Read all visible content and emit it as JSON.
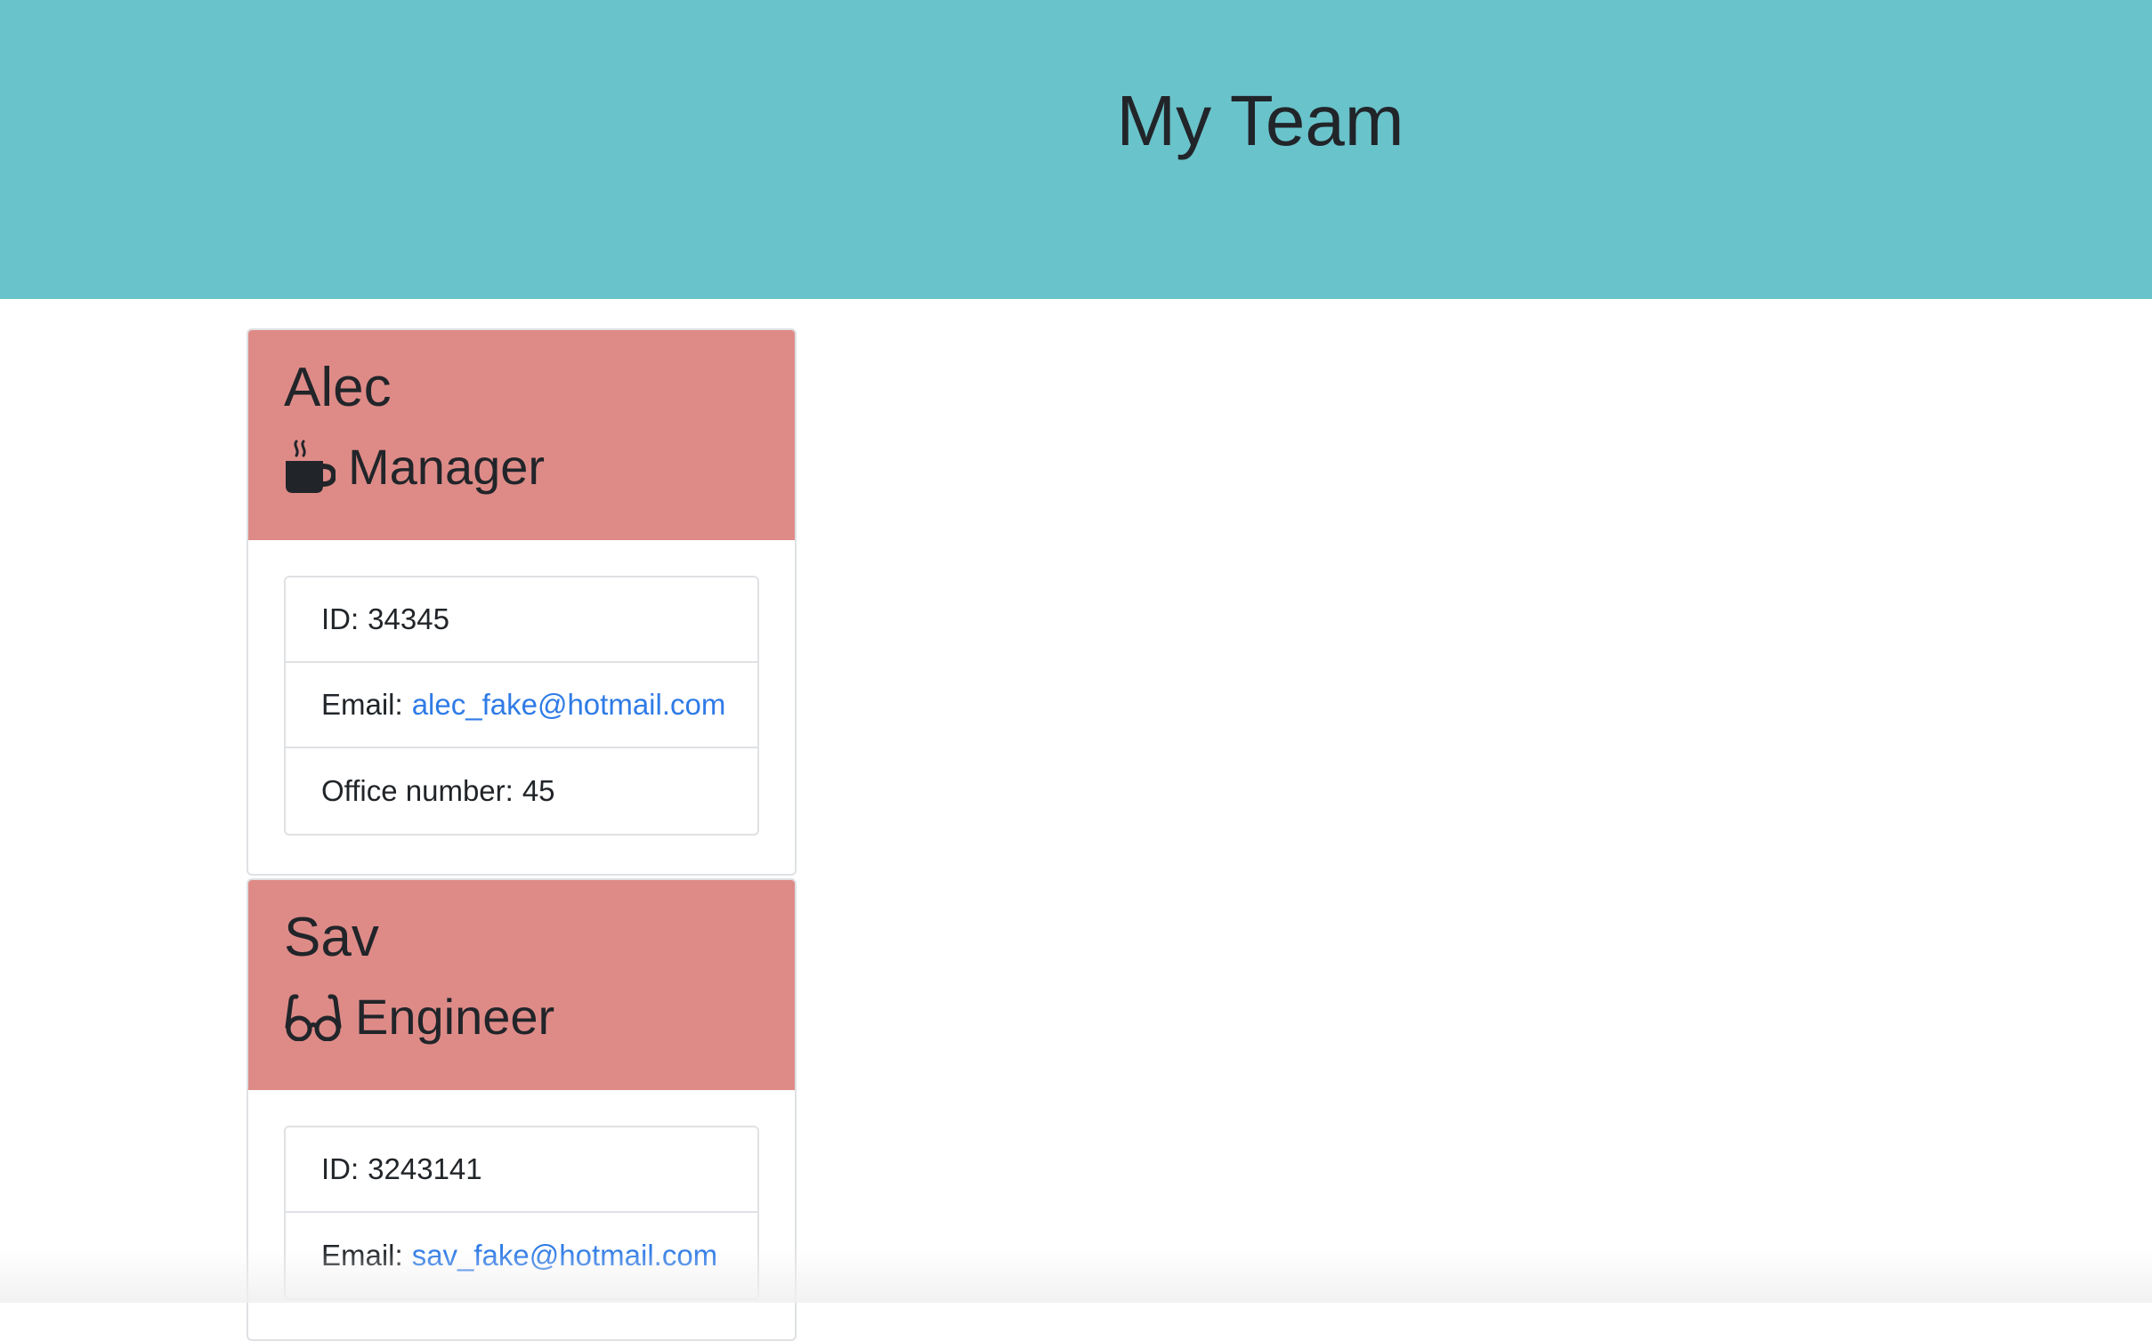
{
  "header": {
    "title": "My Team",
    "background_color": "#69c3cb"
  },
  "employees": [
    {
      "name": "Alec",
      "role": "Manager",
      "role_icon": "mug-hot-icon",
      "header_color": "#de8b88",
      "id_label": "ID:",
      "id_value": "34345",
      "email_label": "Email:",
      "email_value": "alec_fake@hotmail.com",
      "extra_label": "Office number:",
      "extra_value": "45"
    },
    {
      "name": "Sav",
      "role": "Engineer",
      "role_icon": "glasses-icon",
      "header_color": "#de8b88",
      "id_label": "ID:",
      "id_value": "3243141",
      "email_label": "Email:",
      "email_value": "sav_fake@hotmail.com"
    }
  ],
  "link_color": "#2f7be6"
}
